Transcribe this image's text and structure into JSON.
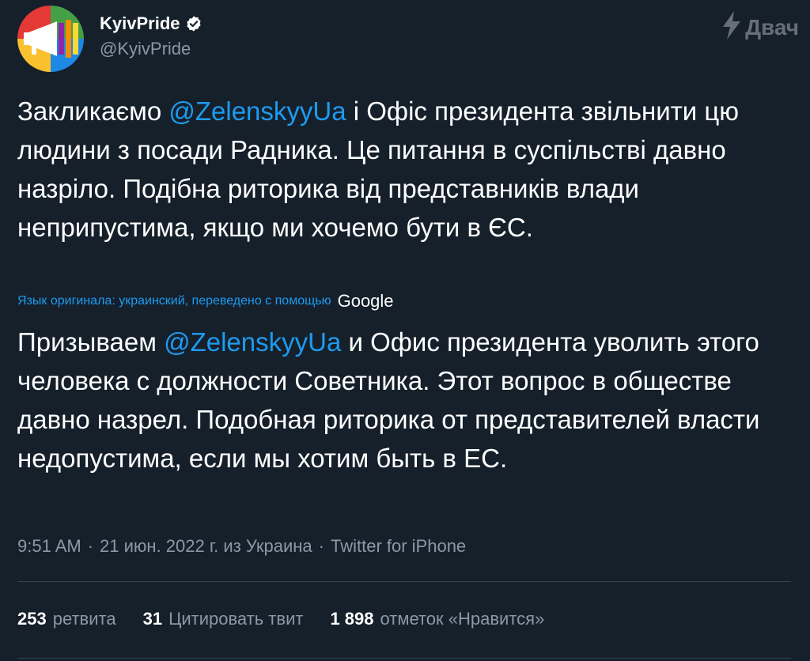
{
  "author": {
    "display_name": "KyivPride",
    "handle": "@KyivPride",
    "verified_icon": "verified-badge-icon",
    "avatar_icon": "rainbow-megaphone-avatar"
  },
  "watermark": {
    "text": "Двач",
    "icon": "lightning-icon"
  },
  "tweet": {
    "p1_before": "Закликаємо ",
    "p1_mention": "@ZelenskyyUa",
    "p1_after": " і Офіс президента звільнити цю людини з посади Радника. Це питання в суспільстві давно назріло. Подібна риторика від представників влади неприпустима, якщо ми хочемо бути в ЄС."
  },
  "translation": {
    "note": "Язык оригинала: украинский, переведено с помощью",
    "provider": "Google",
    "t1_before": "Призываем ",
    "t1_mention": "@ZelenskyyUa",
    "t1_after": " и Офис президента уволить этого человека с должности Советника. Этот вопрос в обществе давно назрел. Подобная риторика от представителей власти недопустима, если мы хотим быть в ЕС."
  },
  "meta": {
    "time": "9:51 AM",
    "sep": "·",
    "date": "21 июн. 2022 г. из Украина",
    "source": "Twitter for iPhone"
  },
  "stats": {
    "retweets_count": "253",
    "retweets_label": "ретвита",
    "quotes_count": "31",
    "quotes_label": "Цитировать твит",
    "likes_count": "1 898",
    "likes_label": "отметок «Нравится»"
  },
  "colors": {
    "background": "#15202b",
    "accent": "#1d9bf0",
    "muted": "#8b98a5"
  }
}
